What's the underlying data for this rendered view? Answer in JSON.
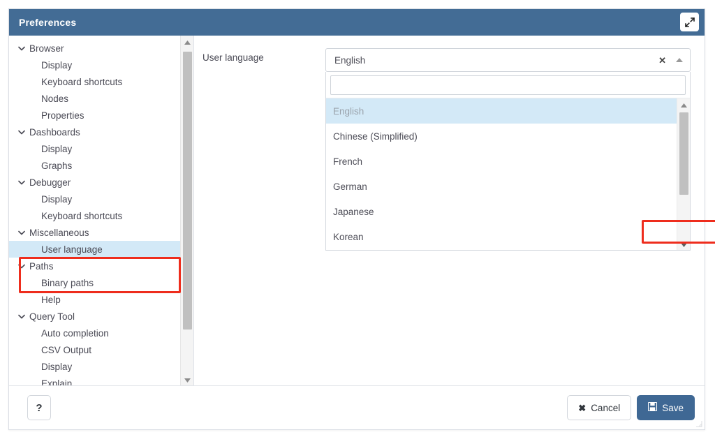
{
  "window": {
    "title": "Preferences",
    "expand_icon": "expand-diagonal-icon"
  },
  "sidebar": {
    "items": [
      {
        "label": "Browser",
        "type": "group",
        "expanded": true,
        "selected": false
      },
      {
        "label": "Display",
        "type": "leaf",
        "selected": false
      },
      {
        "label": "Keyboard shortcuts",
        "type": "leaf",
        "selected": false
      },
      {
        "label": "Nodes",
        "type": "leaf",
        "selected": false
      },
      {
        "label": "Properties",
        "type": "leaf",
        "selected": false
      },
      {
        "label": "Dashboards",
        "type": "group",
        "expanded": true,
        "selected": false
      },
      {
        "label": "Display",
        "type": "leaf",
        "selected": false
      },
      {
        "label": "Graphs",
        "type": "leaf",
        "selected": false
      },
      {
        "label": "Debugger",
        "type": "group",
        "expanded": true,
        "selected": false
      },
      {
        "label": "Display",
        "type": "leaf",
        "selected": false
      },
      {
        "label": "Keyboard shortcuts",
        "type": "leaf",
        "selected": false
      },
      {
        "label": "Miscellaneous",
        "type": "group",
        "expanded": true,
        "selected": false
      },
      {
        "label": "User language",
        "type": "leaf",
        "selected": true
      },
      {
        "label": "Paths",
        "type": "group",
        "expanded": true,
        "selected": false
      },
      {
        "label": "Binary paths",
        "type": "leaf",
        "selected": false
      },
      {
        "label": "Help",
        "type": "leaf",
        "selected": false
      },
      {
        "label": "Query Tool",
        "type": "group",
        "expanded": true,
        "selected": false
      },
      {
        "label": "Auto completion",
        "type": "leaf",
        "selected": false
      },
      {
        "label": "CSV Output",
        "type": "leaf",
        "selected": false
      },
      {
        "label": "Display",
        "type": "leaf",
        "selected": false
      },
      {
        "label": "Explain",
        "type": "leaf",
        "selected": false
      }
    ],
    "scroll_up_icon": "caret-up-icon",
    "scroll_down_icon": "caret-down-icon"
  },
  "content": {
    "field_label": "User language",
    "combo": {
      "value": "English",
      "clear_icon": "close-x-icon",
      "toggle_icon": "caret-up-icon"
    },
    "search": {
      "value": "",
      "placeholder": ""
    },
    "options": [
      {
        "label": "English",
        "active": true
      },
      {
        "label": "Chinese (Simplified)",
        "active": false
      },
      {
        "label": "French",
        "active": false
      },
      {
        "label": "German",
        "active": false
      },
      {
        "label": "Japanese",
        "active": false
      },
      {
        "label": "Korean",
        "active": false
      }
    ]
  },
  "footer": {
    "help_label": "?",
    "cancel_label": "Cancel",
    "cancel_icon": "close-x-icon",
    "save_label": "Save",
    "save_icon": "floppy-disk-icon"
  },
  "colors": {
    "titlebar": "#436c95",
    "accent": "#3f6894",
    "selection": "#d3e9f7",
    "annotation": "#ee2d1d",
    "text": "#4a4a55"
  }
}
